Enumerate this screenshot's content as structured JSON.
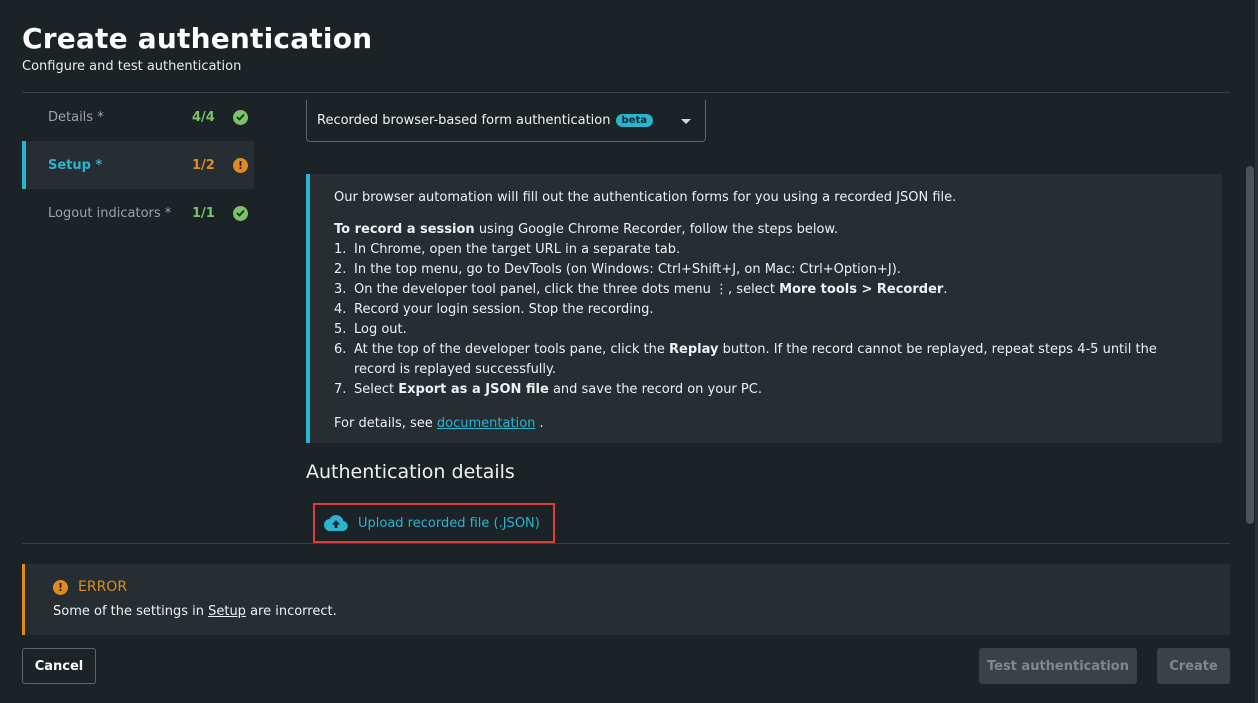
{
  "header": {
    "title": "Create authentication",
    "subtitle": "Configure and test authentication"
  },
  "steps": [
    {
      "label": "Details *",
      "count": "4/4",
      "status": "ok"
    },
    {
      "label": "Setup *",
      "count": "1/2",
      "status": "warn",
      "status_glyph": "!"
    },
    {
      "label": "Logout indicators *",
      "count": "1/1",
      "status": "ok"
    }
  ],
  "auth_type": {
    "selected": "Recorded browser-based form authentication",
    "badge": "beta"
  },
  "info": {
    "intro": "Our browser automation will fill out the authentication forms for you using a recorded JSON file.",
    "record_bold": "To record a session",
    "record_rest": " using Google Chrome Recorder, follow the steps below.",
    "steps": {
      "s1": {
        "num": "1.",
        "text": "In Chrome, open the target URL in a separate tab."
      },
      "s2": {
        "num": "2.",
        "text": "In the top menu, go to DevTools (on Windows: Ctrl+Shift+J, on Mac: Ctrl+Option+J)."
      },
      "s3": {
        "num": "3.",
        "pre": "On the developer tool panel, click the three dots menu ⋮, select ",
        "bold": "More tools > Recorder",
        "post": "."
      },
      "s4": {
        "num": "4.",
        "text": "Record your login session. Stop the recording."
      },
      "s5": {
        "num": "5.",
        "text": "Log out."
      },
      "s6": {
        "num": "6.",
        "pre": "At the top of the developer tools pane, click the ",
        "bold": "Replay",
        "post": " button. If the record cannot be replayed, repeat steps 4-5 until the record is replayed successfully."
      },
      "s7": {
        "num": "7.",
        "pre": "Select ",
        "bold": "Export as a JSON file",
        "post": " and save the record on your PC."
      }
    },
    "details_pre": "For details, see ",
    "details_link": "documentation",
    "details_post": " ."
  },
  "auth_details": {
    "heading": "Authentication details",
    "upload_label": "Upload recorded file (.JSON)"
  },
  "error": {
    "title": "ERROR",
    "glyph": "!",
    "text_pre": "Some of the settings in ",
    "text_link": "Setup",
    "text_post": " are incorrect."
  },
  "footer": {
    "cancel": "Cancel",
    "test": "Test authentication",
    "create": "Create"
  },
  "colors": {
    "accent": "#2ab4cf",
    "ok": "#7ac26a",
    "warn": "#e08b1f",
    "highlight": "#e03b3b"
  }
}
